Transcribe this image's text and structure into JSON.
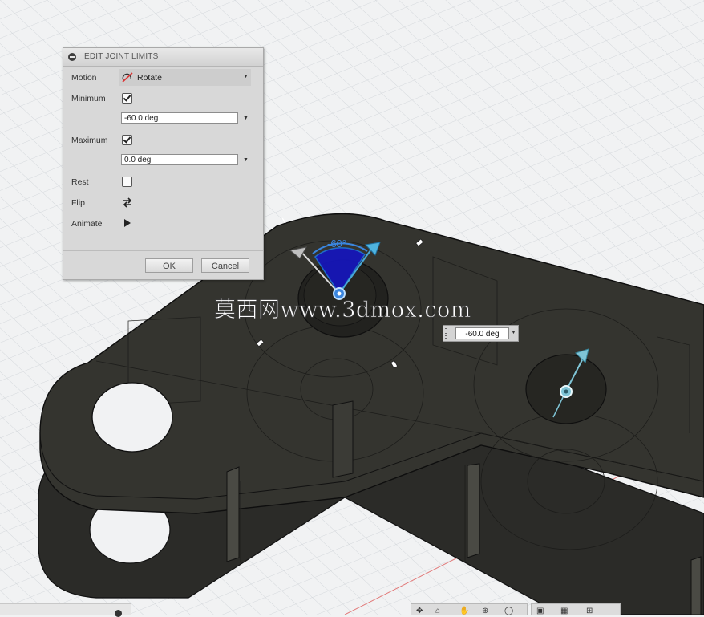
{
  "dialog": {
    "title": "EDIT JOINT LIMITS",
    "motion": {
      "label": "Motion",
      "value": "Rotate",
      "icon": "rotate-motion-icon"
    },
    "minimum": {
      "label": "Minimum",
      "checked": true,
      "value": "-60.0 deg"
    },
    "maximum": {
      "label": "Maximum",
      "checked": true,
      "value": "0.0 deg"
    },
    "rest": {
      "label": "Rest",
      "checked": false
    },
    "flip": {
      "label": "Flip",
      "icon": "flip-icon"
    },
    "animate": {
      "label": "Animate",
      "icon": "play-icon"
    },
    "ok_label": "OK",
    "cancel_label": "Cancel"
  },
  "canvas": {
    "angle_label": "-60°",
    "angle_input_value": "-60.0 deg",
    "watermark": "莫西网www.3dmox.com",
    "model_color": "#2e2e2a",
    "accent_blue": "#1f6fd1",
    "grid_color": "#d5d8db",
    "background": "#f1f2f3"
  },
  "toolbars": {
    "navigation_icons": [
      "orbit-icon",
      "look-at-icon",
      "pan-icon",
      "zoom-icon",
      "fit-icon"
    ],
    "display_icons": [
      "display-settings-icon",
      "grid-icon",
      "viewports-icon"
    ]
  }
}
